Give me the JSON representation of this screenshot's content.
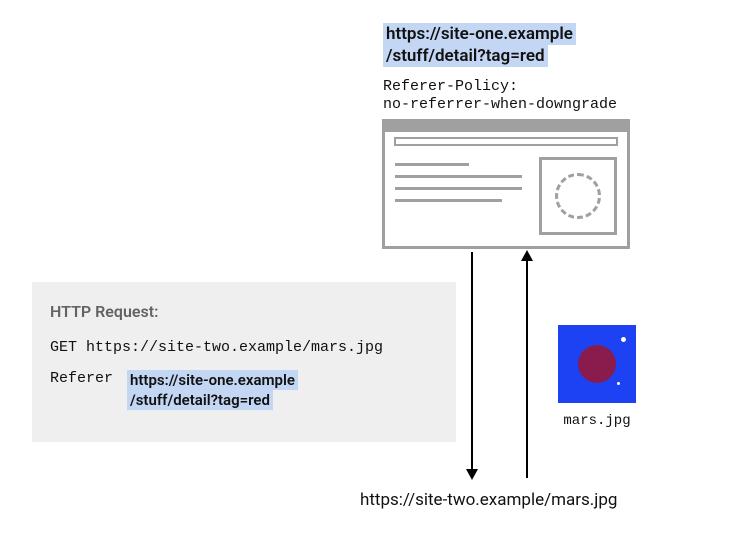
{
  "top": {
    "url_line1": "https://site-one.example",
    "url_line2": "/stuff/detail?tag=red"
  },
  "policy": {
    "label": "Referer-Policy:",
    "value": "no-referrer-when-downgrade"
  },
  "request": {
    "title": "HTTP Request:",
    "method_line": "GET https://site-two.example/mars.jpg",
    "referer_label": "Referer",
    "referer_val_line1": "https://site-one.example",
    "referer_val_line2": "/stuff/detail?tag=red"
  },
  "thumb": {
    "filename": "mars.jpg"
  },
  "bottom": {
    "url": "https://site-two.example/mars.jpg"
  }
}
